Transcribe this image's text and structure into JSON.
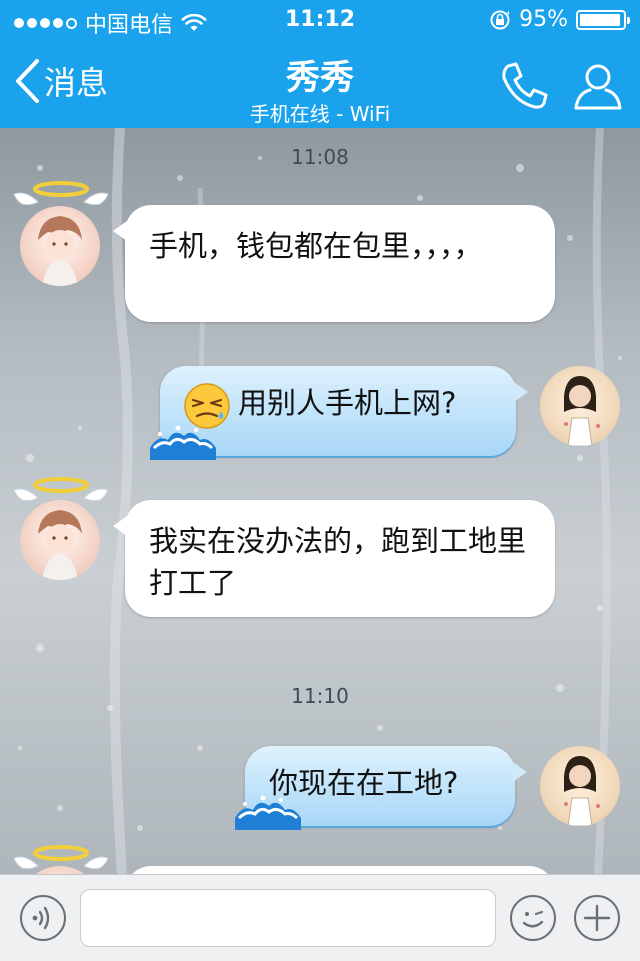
{
  "status_bar": {
    "carrier": "中国电信",
    "time": "11:12",
    "battery_percent": "95%",
    "battery_level": 0.95,
    "signal_bars": 4,
    "signal_max": 5
  },
  "nav": {
    "back_label": "消息",
    "title": "秀秀",
    "subtitle": "手机在线 - WiFi"
  },
  "colors": {
    "accent": "#1aa3ec",
    "outgoing_bubble": "#bfe3fa",
    "incoming_bubble": "#ffffff"
  },
  "chat": {
    "timestamps": [
      "11:08",
      "11:10"
    ],
    "messages": [
      {
        "from": "friend",
        "text": "手机，钱包都在包里，，，，"
      },
      {
        "from": "me",
        "emoji": "sweat-face",
        "text": "用别人手机上网?"
      },
      {
        "from": "friend",
        "text": "我实在没办法的，跑到工地里打工了"
      },
      {
        "from": "me",
        "text": "你现在在工地?"
      }
    ]
  },
  "input": {
    "placeholder": ""
  },
  "icons": [
    "voice-icon",
    "emoji-icon",
    "plus-icon",
    "phone-icon",
    "profile-icon",
    "back-chevron-icon"
  ]
}
